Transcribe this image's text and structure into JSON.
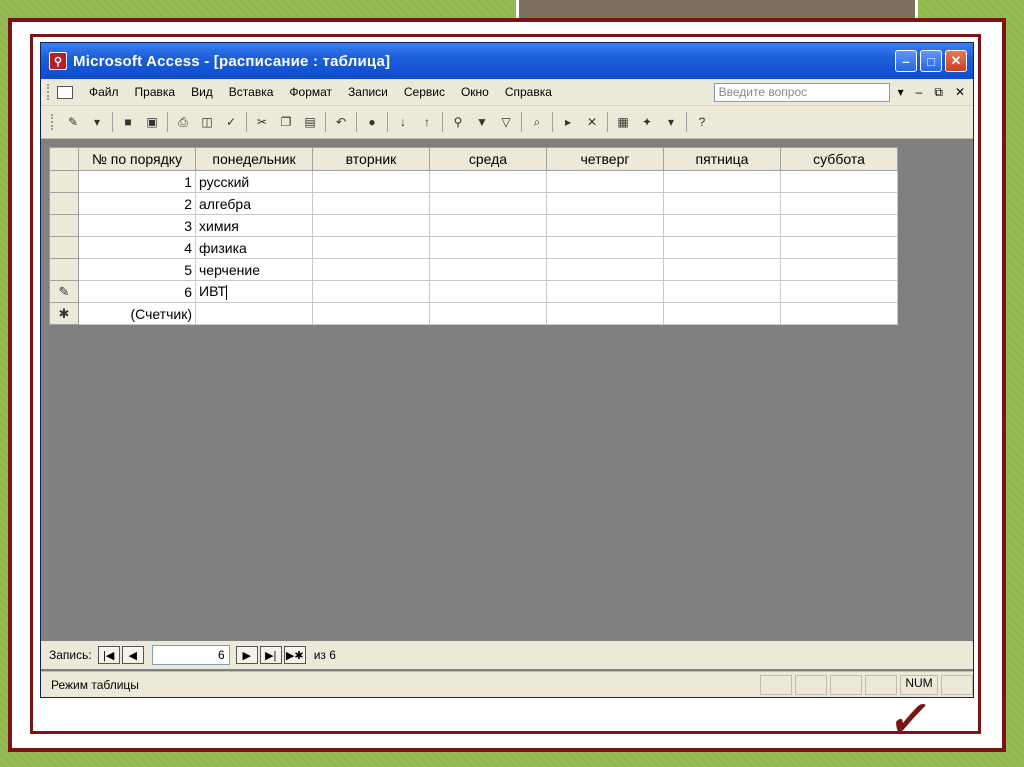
{
  "window": {
    "title": "Microsoft Access - [расписание : таблица]",
    "controls": {
      "minimize": "–",
      "maximize": "□",
      "close": "✕"
    }
  },
  "menu": {
    "items": [
      "Файл",
      "Правка",
      "Вид",
      "Вставка",
      "Формат",
      "Записи",
      "Сервис",
      "Окно",
      "Справка"
    ],
    "help_placeholder": "Введите вопрос",
    "right_controls": [
      "▾",
      "–",
      "⧉",
      "✕"
    ]
  },
  "table": {
    "columns": [
      "№ по порядку",
      "понедельник",
      "вторник",
      "среда",
      "четверг",
      "пятница",
      "суббота"
    ],
    "rows": [
      {
        "selector": "",
        "num": "1",
        "mon": "русский"
      },
      {
        "selector": "",
        "num": "2",
        "mon": "алгебра"
      },
      {
        "selector": "",
        "num": "3",
        "mon": "химия"
      },
      {
        "selector": "",
        "num": "4",
        "mon": "физика"
      },
      {
        "selector": "",
        "num": "5",
        "mon": "черчение"
      },
      {
        "selector": "✎",
        "num": "6",
        "mon": "ИВТ"
      }
    ],
    "new_row": {
      "selector": "✱",
      "num": "(Счетчик)"
    }
  },
  "navigation": {
    "label": "Запись:",
    "current": "6",
    "of_label": "из 6"
  },
  "status": {
    "mode": "Режим таблицы",
    "num_indicator": "NUM"
  },
  "colors": {
    "title_bar": "#1d5fd8",
    "frame": "#7a1414",
    "background": "#8fb84e"
  }
}
